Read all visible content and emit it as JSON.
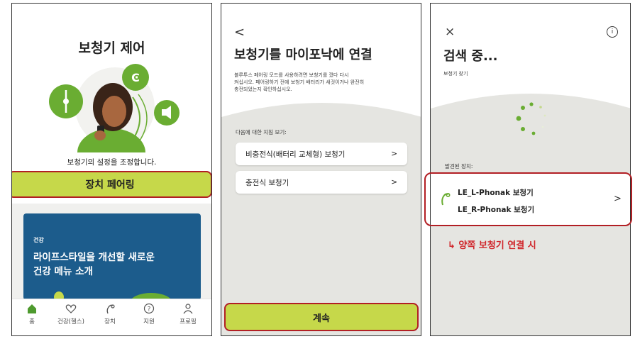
{
  "screen1": {
    "title": "보청기 제어",
    "subtitle": "보청기의 설정을 조정합니다.",
    "pair_button": "장치 페어링",
    "banner": {
      "tag": "건강",
      "headline_line1": "라이프스타일을 개선할 새로운",
      "headline_line2": "건강 메뉴 소개"
    },
    "nav": [
      {
        "label": "홈",
        "icon": "home-icon"
      },
      {
        "label": "건강(헬스)",
        "icon": "heart-icon"
      },
      {
        "label": "장치",
        "icon": "hearing-aid-icon"
      },
      {
        "label": "지원",
        "icon": "help-icon"
      },
      {
        "label": "프로필",
        "icon": "profile-icon"
      }
    ],
    "colors": {
      "accent": "#c6d84a",
      "brand_green": "#6aad32",
      "banner_blue": "#1c5c8c",
      "highlight_border": "#b21f24"
    }
  },
  "screen2": {
    "back": "<",
    "title": "보청기를 마이포낙에 연결",
    "desc_line1": "블루투스 페어링 모드를 사용하려면 보청기를 껐다 다시",
    "desc_line2": "켜십시오. 페어링하기 전에 보청기 배터리가 새것이거나 완전히",
    "desc_line3": "충전되었는지 확인하십시오.",
    "guide_label": "다음에 대한 지침 보기:",
    "options": [
      {
        "label": "비충전식(배터리 교체형) 보청기",
        "chevron": ">"
      },
      {
        "label": "충전식 보청기",
        "chevron": ">"
      }
    ],
    "continue_button": "계속"
  },
  "screen3": {
    "close": "×",
    "info": "i",
    "title": "검색 중...",
    "subtitle": "보청기 찾기",
    "found_label": "발견된 장치:",
    "devices": [
      "LE_L-Phonak 보청기",
      "LE_R-Phonak 보청기"
    ],
    "chevron": ">",
    "annotation": "↳ 양쪽 보청기 연결 시"
  }
}
